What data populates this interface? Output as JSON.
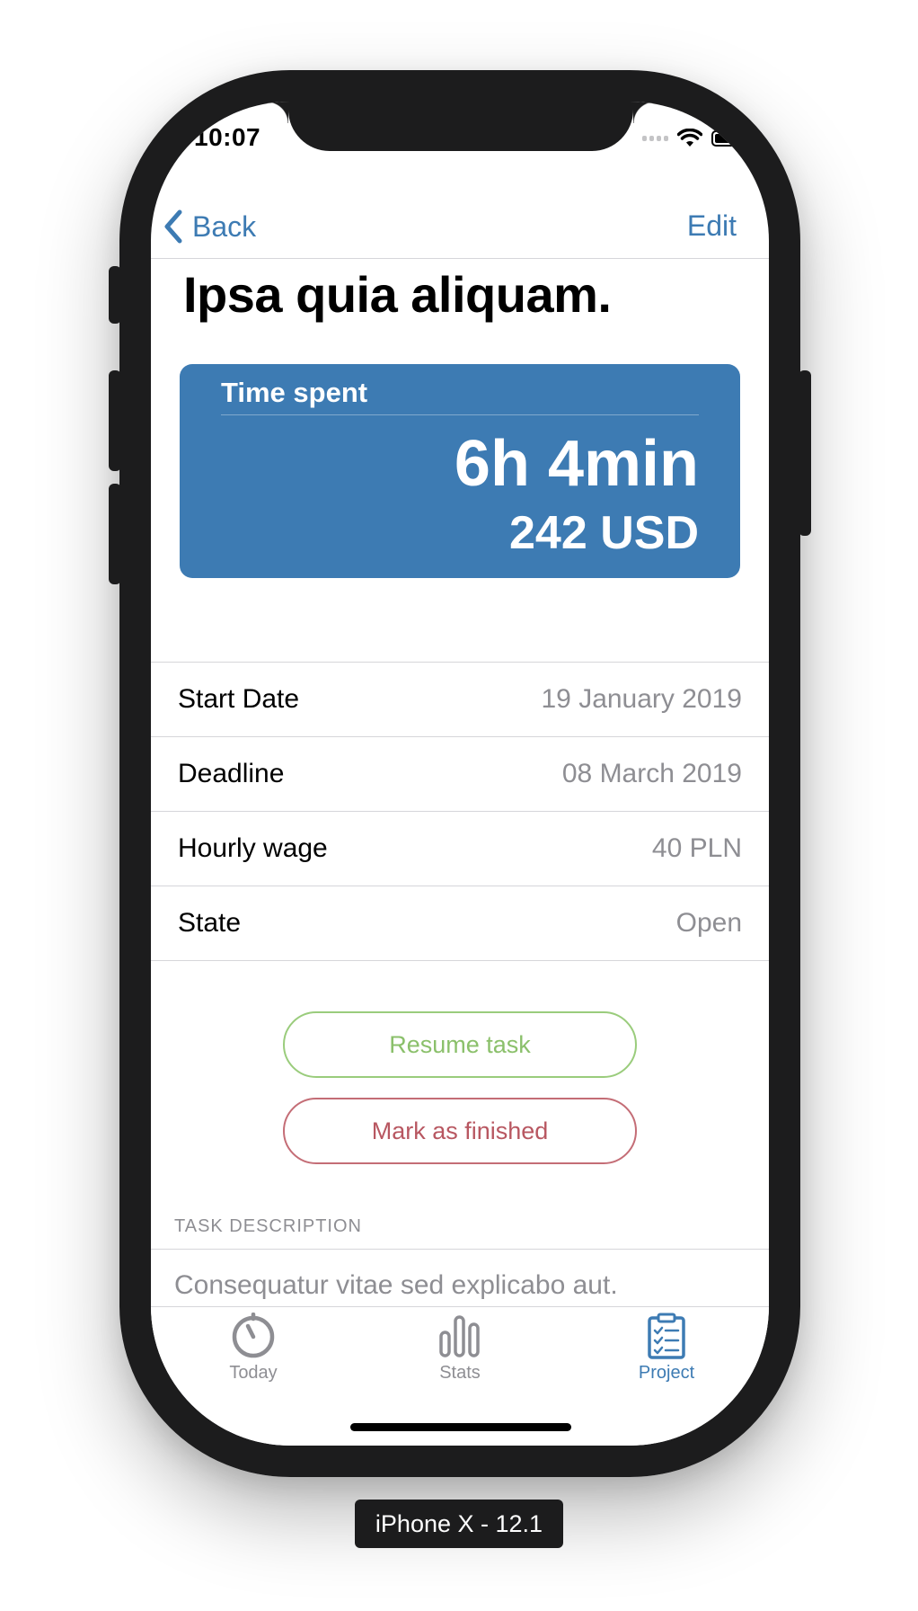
{
  "status_bar": {
    "time": "10:07"
  },
  "nav": {
    "back_label": "Back",
    "edit_label": "Edit"
  },
  "task": {
    "title": "Ipsa quia aliquam."
  },
  "time_card": {
    "label": "Time spent",
    "duration": "6h 4min",
    "amount": "242 USD"
  },
  "details": [
    {
      "label": "Start Date",
      "value": "19 January 2019"
    },
    {
      "label": "Deadline",
      "value": "08 March 2019"
    },
    {
      "label": "Hourly wage",
      "value": "40 PLN"
    },
    {
      "label": "State",
      "value": "Open"
    }
  ],
  "actions": {
    "resume_label": "Resume task",
    "finish_label": "Mark as finished"
  },
  "description": {
    "header": "TASK DESCRIPTION",
    "text": "Consequatur vitae sed explicabo aut."
  },
  "tabs": [
    {
      "label": "Today",
      "icon": "timer-icon"
    },
    {
      "label": "Stats",
      "icon": "bar-chart-icon"
    },
    {
      "label": "Project",
      "icon": "clipboard-icon",
      "active": true
    }
  ],
  "device_label": "iPhone X - 12.1",
  "colors": {
    "accent": "#3d7bb3",
    "resume": "#8bc06b",
    "finish": "#b85761",
    "secondary_text": "#8e8e93"
  }
}
